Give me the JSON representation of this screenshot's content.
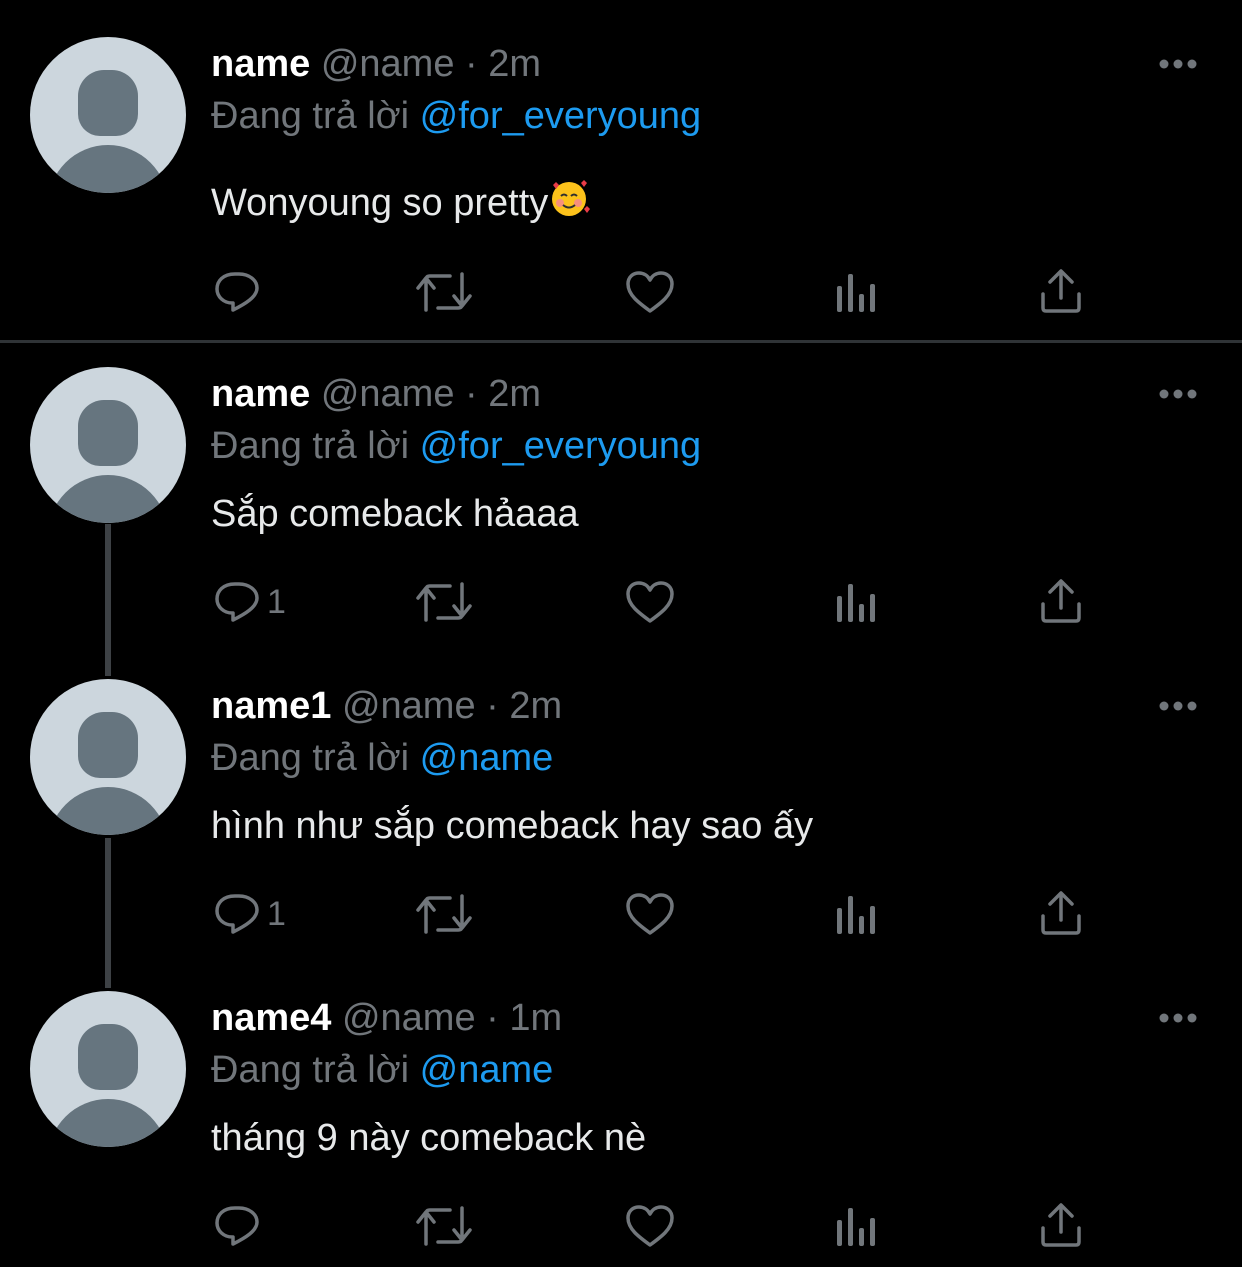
{
  "tweets": [
    {
      "display_name": "name",
      "handle": "@name",
      "separator": "·",
      "time": "2m",
      "reply_label": "Đang trả lời",
      "reply_target": "@for_everyoung",
      "text": "Wonyoung so pretty",
      "emoji": "smiling-face-with-hearts",
      "reply_count": ""
    },
    {
      "display_name": "name",
      "handle": "@name",
      "separator": "·",
      "time": "2m",
      "reply_label": "Đang trả lời",
      "reply_target": "@for_everyoung",
      "text": "Sắp comeback hảaaa",
      "reply_count": "1"
    },
    {
      "display_name": "name1",
      "handle": "@name",
      "separator": "·",
      "time": "2m",
      "reply_label": "Đang trả lời",
      "reply_target": "@name",
      "text": "hình như sắp comeback hay sao ấy",
      "reply_count": "1"
    },
    {
      "display_name": "name4",
      "handle": "@name",
      "separator": "·",
      "time": "1m",
      "reply_label": "Đang trả lời",
      "reply_target": "@name",
      "text": "tháng 9 này comeback nè",
      "reply_count": ""
    }
  ],
  "icons": {
    "reply": "reply-icon",
    "retweet": "retweet-icon",
    "like": "like-icon",
    "views": "views-icon",
    "share": "share-icon",
    "more": "more-icon"
  },
  "colors": {
    "background": "#000000",
    "text": "#e7e9ea",
    "secondary": "#71767b",
    "link": "#1d9bf0",
    "divider": "#2f3336"
  }
}
